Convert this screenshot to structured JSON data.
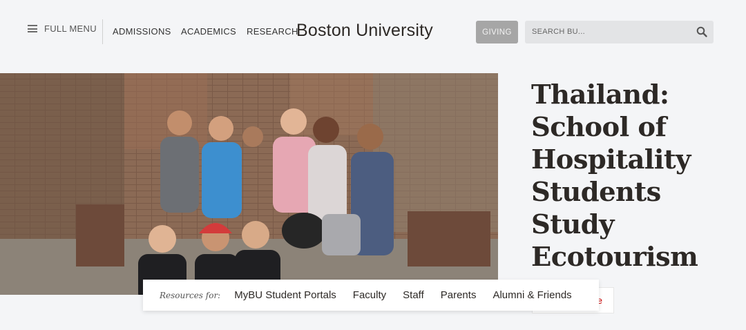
{
  "header": {
    "menu_label": "FULL MENU",
    "nav": {
      "admissions": "ADMISSIONS",
      "academics": "ACADEMICS",
      "research": "RESEARCH"
    },
    "logo": "Boston University",
    "giving_label": "GIVING",
    "search_placeholder": "SEARCH BU..."
  },
  "hero": {
    "image_icon": "group-photo",
    "headline": "Thailand: School of Hospitality Students Study Ecotourism",
    "read_more_label": "e"
  },
  "resources": {
    "label": "Resources for:",
    "links": [
      "MyBU Student Portals",
      "Faculty",
      "Staff",
      "Parents",
      "Alumni & Friends"
    ]
  },
  "colors": {
    "background": "#f4f5f7",
    "giving_button": "#a6a6a6",
    "search_bg": "#e3e4e6",
    "read_more_accent": "#cc0000",
    "headline": "#2d2926"
  }
}
